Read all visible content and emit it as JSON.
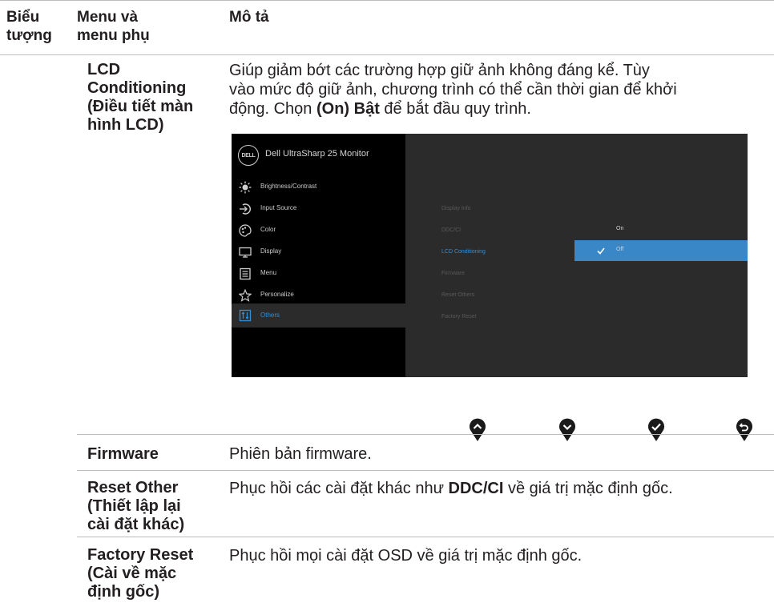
{
  "header": {
    "col_icon": [
      "Biểu",
      "tượng"
    ],
    "col_menu": [
      "Menu và",
      "menu phụ"
    ],
    "col_desc": "Mô tả"
  },
  "rows": {
    "lcd": {
      "menu": [
        "LCD",
        "Conditioning",
        "(Điều tiết màn",
        "hình LCD)"
      ],
      "desc_lines": [
        "Giúp giảm bớt các trường hợp giữ ảnh không đáng kể. Tùy",
        "vào mức độ giữ ảnh, chương trình có thể cần thời gian để khởi"
      ],
      "desc_l3_pre": "động. Chọn ",
      "desc_l3_bold": "(On) Bật",
      "desc_l3_post": " để bắt đầu quy trình."
    },
    "firmware": {
      "menu": "Firmware",
      "desc": "Phiên bản firmware."
    },
    "reset_other": {
      "menu": [
        "Reset Other",
        "(Thiết lập lại",
        "cài đặt khác)"
      ],
      "desc_pre": "Phục hồi các cài đặt khác như ",
      "desc_bold": "DDC/CI",
      "desc_post": " về giá trị mặc định gốc."
    },
    "factory_reset": {
      "menu": [
        "Factory Reset",
        "(Cài về mặc",
        "định gốc)"
      ],
      "desc": "Phục hồi mọi cài đặt OSD về giá trị mặc định gốc."
    }
  },
  "osd": {
    "logo": "DELL",
    "title": "Dell UltraSharp 25 Monitor",
    "menu": [
      {
        "label": "Brightness/Contrast",
        "icon": "brightness-icon"
      },
      {
        "label": "Input Source",
        "icon": "input-source-icon"
      },
      {
        "label": "Color",
        "icon": "color-icon"
      },
      {
        "label": "Display",
        "icon": "display-icon"
      },
      {
        "label": "Menu",
        "icon": "menu-icon"
      },
      {
        "label": "Personalize",
        "icon": "star-icon"
      },
      {
        "label": "Others",
        "icon": "others-icon",
        "selected": true
      }
    ],
    "submenu": [
      "Display Info",
      "DDC/CI",
      "LCD Conditioning",
      "Firmware",
      "Reset Others",
      "Factory Reset"
    ],
    "options": [
      "On",
      "Off"
    ],
    "selected_option": "Off"
  },
  "colors": {
    "accent": "#2f8fd8",
    "selected_option_bg": "#3a87c8"
  },
  "nav_buttons": [
    "up-icon",
    "down-icon",
    "check-icon",
    "back-icon"
  ]
}
